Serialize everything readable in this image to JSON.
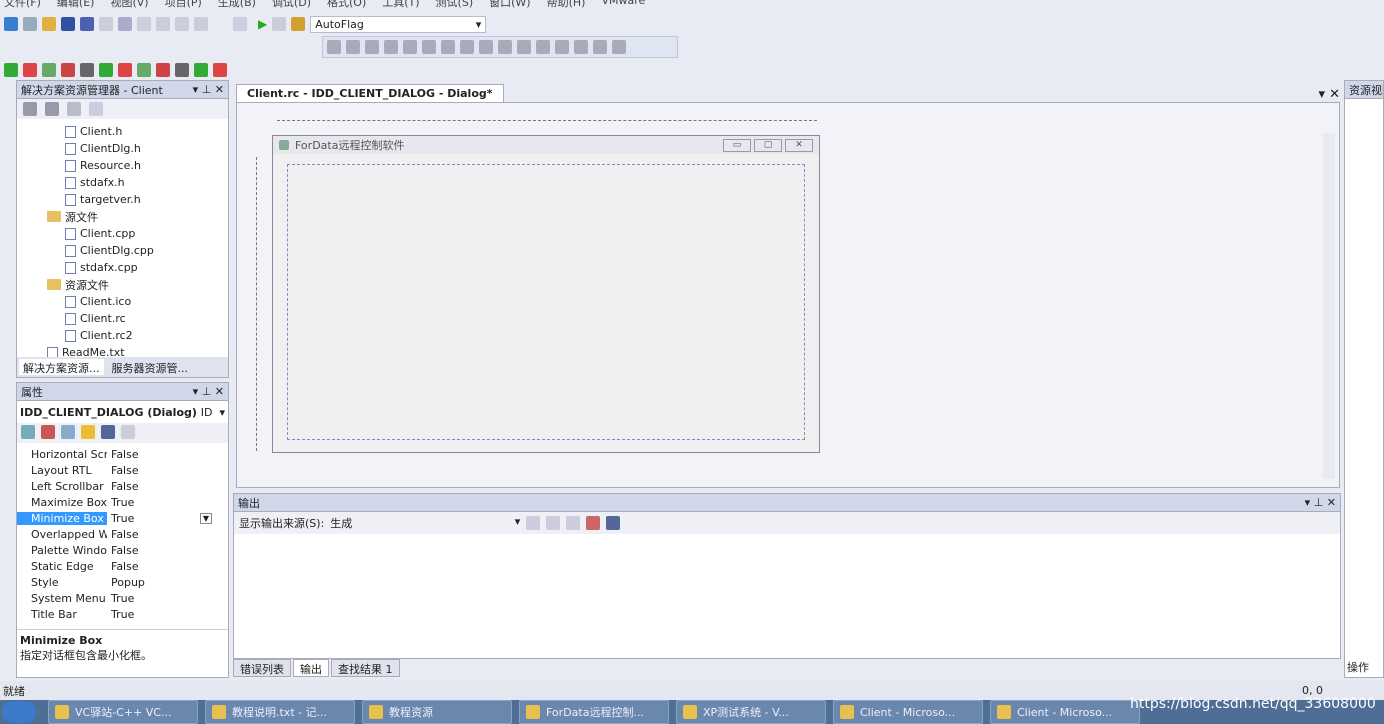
{
  "menu": [
    "文件(F)",
    "编辑(E)",
    "视图(V)",
    "项目(P)",
    "生成(B)",
    "调试(D)",
    "格式(O)",
    "工具(T)",
    "测试(S)",
    "窗口(W)",
    "帮助(H)",
    "VMware"
  ],
  "toolbar": {
    "config_combo": "AutoFlag"
  },
  "solution_explorer": {
    "title": "解决方案资源管理器 - Client",
    "items": [
      {
        "label": "Client.h",
        "type": "h",
        "indent": 2
      },
      {
        "label": "ClientDlg.h",
        "type": "h",
        "indent": 2
      },
      {
        "label": "Resource.h",
        "type": "h",
        "indent": 2
      },
      {
        "label": "stdafx.h",
        "type": "h",
        "indent": 2
      },
      {
        "label": "targetver.h",
        "type": "h",
        "indent": 2
      },
      {
        "label": "源文件",
        "type": "folder",
        "indent": 1
      },
      {
        "label": "Client.cpp",
        "type": "cpp",
        "indent": 2
      },
      {
        "label": "ClientDlg.cpp",
        "type": "cpp",
        "indent": 2
      },
      {
        "label": "stdafx.cpp",
        "type": "cpp",
        "indent": 2
      },
      {
        "label": "资源文件",
        "type": "folder",
        "indent": 1
      },
      {
        "label": "Client.ico",
        "type": "ico",
        "indent": 2
      },
      {
        "label": "Client.rc",
        "type": "rc",
        "indent": 2
      },
      {
        "label": "Client.rc2",
        "type": "rc",
        "indent": 2
      },
      {
        "label": "ReadMe.txt",
        "type": "txt",
        "indent": 1
      }
    ],
    "tabs": [
      "解决方案资源...",
      "服务器资源管..."
    ]
  },
  "properties": {
    "title": "属性",
    "object": "IDD_CLIENT_DIALOG (Dialog)",
    "object_suffix": "ID",
    "rows": [
      [
        "Horizontal Scrc",
        "False"
      ],
      [
        "Layout RTL",
        "False"
      ],
      [
        "Left Scrollbar",
        "False"
      ],
      [
        "Maximize Box",
        "True"
      ],
      [
        "Minimize Box",
        "True"
      ],
      [
        "Overlapped Wi",
        "False"
      ],
      [
        "Palette Window",
        "False"
      ],
      [
        "Static Edge",
        "False"
      ],
      [
        "Style",
        "Popup"
      ],
      [
        "System Menu",
        "True"
      ],
      [
        "Title Bar",
        "True"
      ]
    ],
    "selected": 4,
    "desc_title": "Minimize Box",
    "desc_text": "指定对话框包含最小化框。"
  },
  "editor": {
    "tab": "Client.rc - IDD_CLIENT_DIALOG - Dialog*",
    "dialog_title": "ForData远程控制软件"
  },
  "output": {
    "title": "输出",
    "source_label": "显示输出来源(S):",
    "source_value": "生成",
    "tabs": [
      "错误列表",
      "输出",
      "查找结果 1"
    ]
  },
  "right_panel": {
    "title": "资源视图",
    "bottom": "操作"
  },
  "status": {
    "text": "就绪",
    "coords": "0, 0"
  },
  "taskbar": [
    "VC驿站-C++ VC...",
    "教程说明.txt - 记...",
    "教程资源",
    "ForData远程控制...",
    "XP测试系统 - V...",
    "Client - Microso...",
    "Client - Microso..."
  ],
  "watermark": "https://blog.csdn.net/qq_33608000"
}
